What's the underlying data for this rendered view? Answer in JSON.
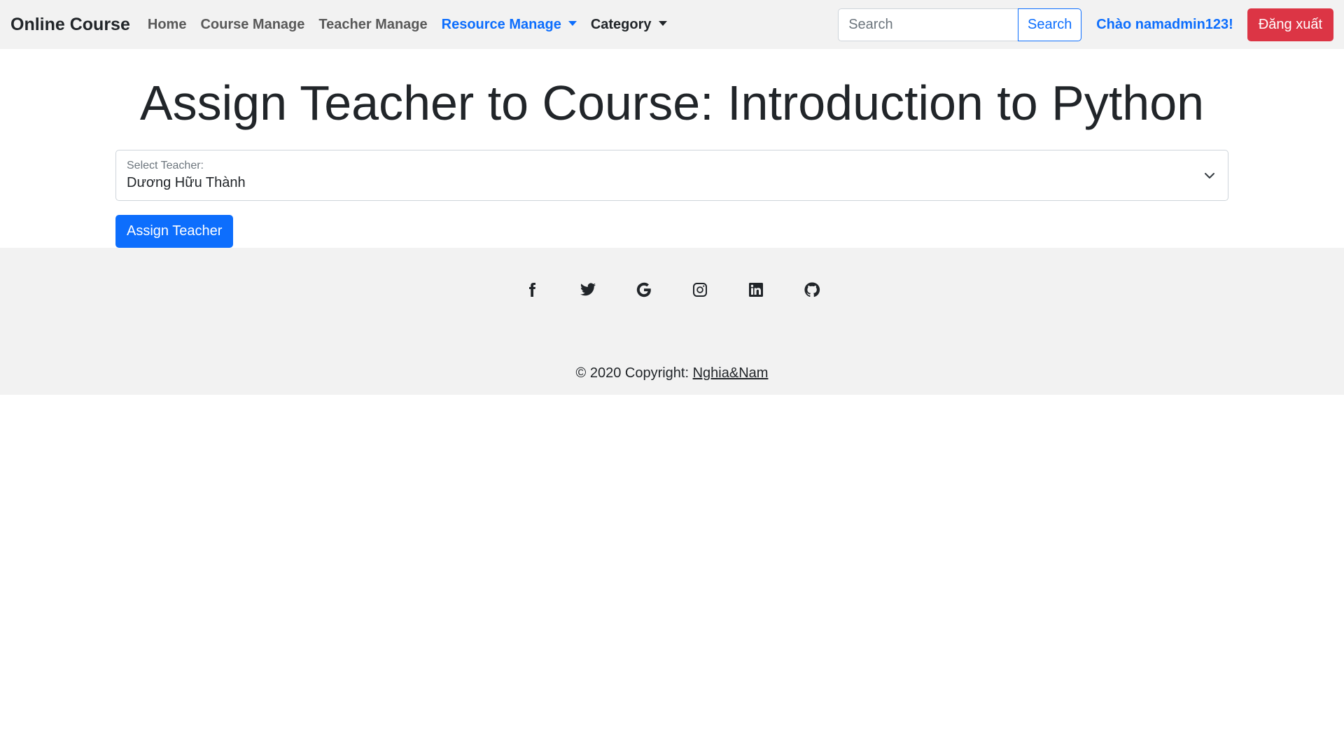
{
  "navbar": {
    "brand": "Online Course",
    "links": [
      {
        "label": "Home"
      },
      {
        "label": "Course Manage"
      },
      {
        "label": "Teacher Manage"
      },
      {
        "label": "Resource Manage"
      },
      {
        "label": "Category"
      }
    ],
    "search": {
      "placeholder": "Search",
      "value": "",
      "button_label": "Search"
    },
    "greeting": "Chào namadmin123!",
    "logout_label": "Đăng xuất"
  },
  "main": {
    "title": "Assign Teacher to Course: Introduction to Python",
    "select": {
      "label": "Select Teacher:",
      "selected": "Dương Hữu Thành"
    },
    "assign_button": "Assign Teacher"
  },
  "footer": {
    "social_icons": [
      "facebook-icon",
      "twitter-icon",
      "google-icon",
      "instagram-icon",
      "linkedin-icon",
      "github-icon"
    ],
    "copyright_prefix": "© 2020 Copyright: ",
    "copyright_link": "Nghia&Nam"
  },
  "colors": {
    "primary": "#0d6efd",
    "danger": "#dc3545",
    "navbar_bg": "#f2f2f2",
    "text": "#212529"
  }
}
